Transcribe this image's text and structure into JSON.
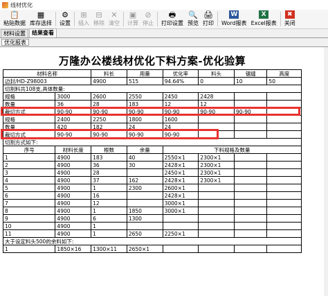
{
  "window": {
    "title": "线材优化"
  },
  "toolbar": {
    "items": [
      {
        "label": "粘贴数据",
        "icon": "paste-icon",
        "glyph": "📋",
        "disabled": false
      },
      {
        "label": "库存选择",
        "icon": "inventory-icon",
        "glyph": "▦",
        "disabled": false
      },
      {
        "label": "设置",
        "icon": "settings-icon",
        "glyph": "⚙",
        "disabled": false
      },
      {
        "label": "插入",
        "icon": "insert-icon",
        "glyph": "⊞",
        "disabled": true
      },
      {
        "label": "移除",
        "icon": "remove-icon",
        "glyph": "⊟",
        "disabled": true
      },
      {
        "label": "清空",
        "icon": "clear-icon",
        "glyph": "✕",
        "disabled": true
      },
      {
        "label": "计算",
        "icon": "calculate-icon",
        "glyph": "▣",
        "disabled": true
      },
      {
        "label": "停止",
        "icon": "stop-icon",
        "glyph": "⊘",
        "disabled": true
      },
      {
        "label": "打印设置",
        "icon": "print-setup-icon",
        "glyph": "🖶",
        "disabled": false
      },
      {
        "label": "预览",
        "icon": "preview-icon",
        "glyph": "🔍",
        "disabled": false
      },
      {
        "label": "打印",
        "icon": "print-icon",
        "glyph": "🖨",
        "disabled": false
      },
      {
        "label": "Word报表",
        "icon": "word-icon",
        "glyph": "W",
        "disabled": false
      },
      {
        "label": "Excel报表",
        "icon": "excel-icon",
        "glyph": "X",
        "disabled": false
      },
      {
        "label": "关闭",
        "icon": "close-icon",
        "glyph": "✖",
        "disabled": false
      }
    ]
  },
  "tabs": [
    {
      "label": "材料设置",
      "active": false
    },
    {
      "label": "结果查看",
      "active": true
    }
  ],
  "subtab": {
    "label": "优化报表"
  },
  "report": {
    "title": "万隆办公楼线材优化下料方案-优化验算",
    "summary": {
      "headers": [
        "材料名称",
        "料长",
        "用量",
        "优化率",
        "料头",
        "锯缝",
        "高度"
      ],
      "row": [
        "边封/HD-Z98003",
        "4900",
        "515",
        "94.64%",
        "0",
        "10",
        "50"
      ]
    },
    "detail_label": "切割料共108支,具体数量:",
    "groups": [
      {
        "rows": [
          {
            "label": "规格",
            "values": [
              "3000",
              "2600",
              "2550",
              "2450",
              "2428"
            ]
          },
          {
            "label": "数量",
            "values": [
              "36",
              "28",
              "183",
              "12",
              "12"
            ]
          },
          {
            "label": "裁切方式",
            "values": [
              "90-90",
              "90-90",
              "90-90",
              "90-90",
              "90-90",
              "90-90"
            ]
          }
        ]
      },
      {
        "rows": [
          {
            "label": "规格",
            "values": [
              "2400",
              "2250",
              "1800",
              "1600",
              ""
            ]
          },
          {
            "label": "数量",
            "values": [
              "420",
              "182",
              "24",
              "24",
              ""
            ]
          },
          {
            "label": "裁切方式",
            "values": [
              "90-90",
              "90-90",
              "90-90",
              "90-90",
              ""
            ]
          }
        ]
      }
    ],
    "cut_label": "切割方式如下:",
    "cut_headers": [
      "序号",
      "材料长度",
      "根数",
      "余量",
      "下料规格及数量"
    ],
    "cut_rows": [
      [
        "1",
        "4900",
        "183",
        "40",
        "2550×1",
        "2300×1"
      ],
      [
        "2",
        "4900",
        "36",
        "30",
        "2428×1",
        "2300×1"
      ],
      [
        "3",
        "4900",
        "28",
        "",
        "2450×1",
        "2300×1"
      ],
      [
        "4",
        "4900",
        "37",
        "162",
        "2428×1",
        "2300×1"
      ],
      [
        "5",
        "4900",
        "1",
        "2300",
        "2600×1",
        ""
      ],
      [
        "6",
        "4900",
        "16",
        "",
        "2428×1",
        ""
      ],
      [
        "7",
        "4900",
        "12",
        "",
        "3000×1",
        ""
      ],
      [
        "8",
        "4900",
        "1",
        "1850",
        "3000×1",
        ""
      ],
      [
        "9",
        "4900",
        "6",
        "1300",
        "",
        ""
      ],
      [
        "10",
        "4900",
        "1",
        "",
        "",
        ""
      ],
      [
        "11",
        "4900",
        "1",
        "2650",
        "2250×1",
        ""
      ]
    ],
    "remnant_label": "大于设定料头500的余料如下:",
    "remnant_row": [
      "1",
      "1850×16",
      "1300×11",
      "2650×1"
    ]
  }
}
